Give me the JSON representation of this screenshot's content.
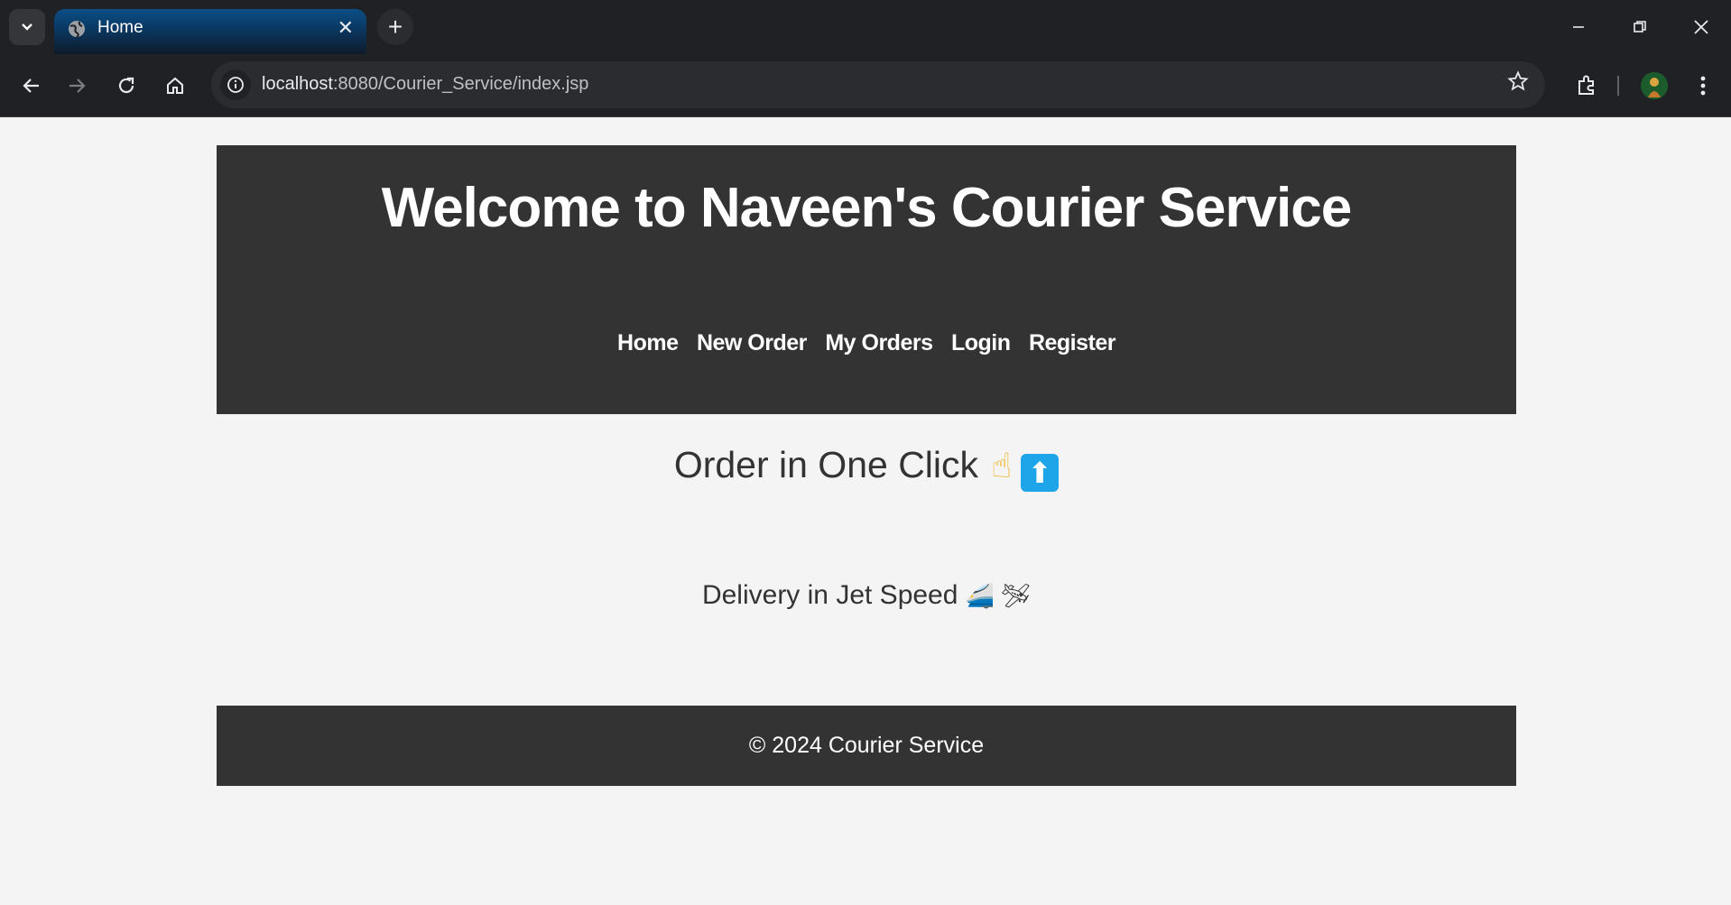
{
  "browser": {
    "tab_title": "Home",
    "tab_close": "✕",
    "new_tab": "+",
    "url_host": "localhost",
    "url_rest": ":8080/Courier_Service/index.jsp"
  },
  "page": {
    "heading": "Welcome to Naveen's Courier Service",
    "nav": [
      "Home",
      "New Order",
      "My Orders",
      "Login",
      "Register"
    ],
    "subheading": "Order in One Click",
    "subheading_emoji_hand": "☝",
    "subheading_emoji_arrow": "⬆",
    "tagline": "Delivery in Jet Speed",
    "tagline_emojis": "🚄 🛩",
    "footer": "© 2024 Courier Service"
  },
  "colors": {
    "header_bg": "#333333",
    "page_bg": "#f4f4f4",
    "text": "#333333",
    "arrow_emoji_bg": "#1ea4e8"
  }
}
